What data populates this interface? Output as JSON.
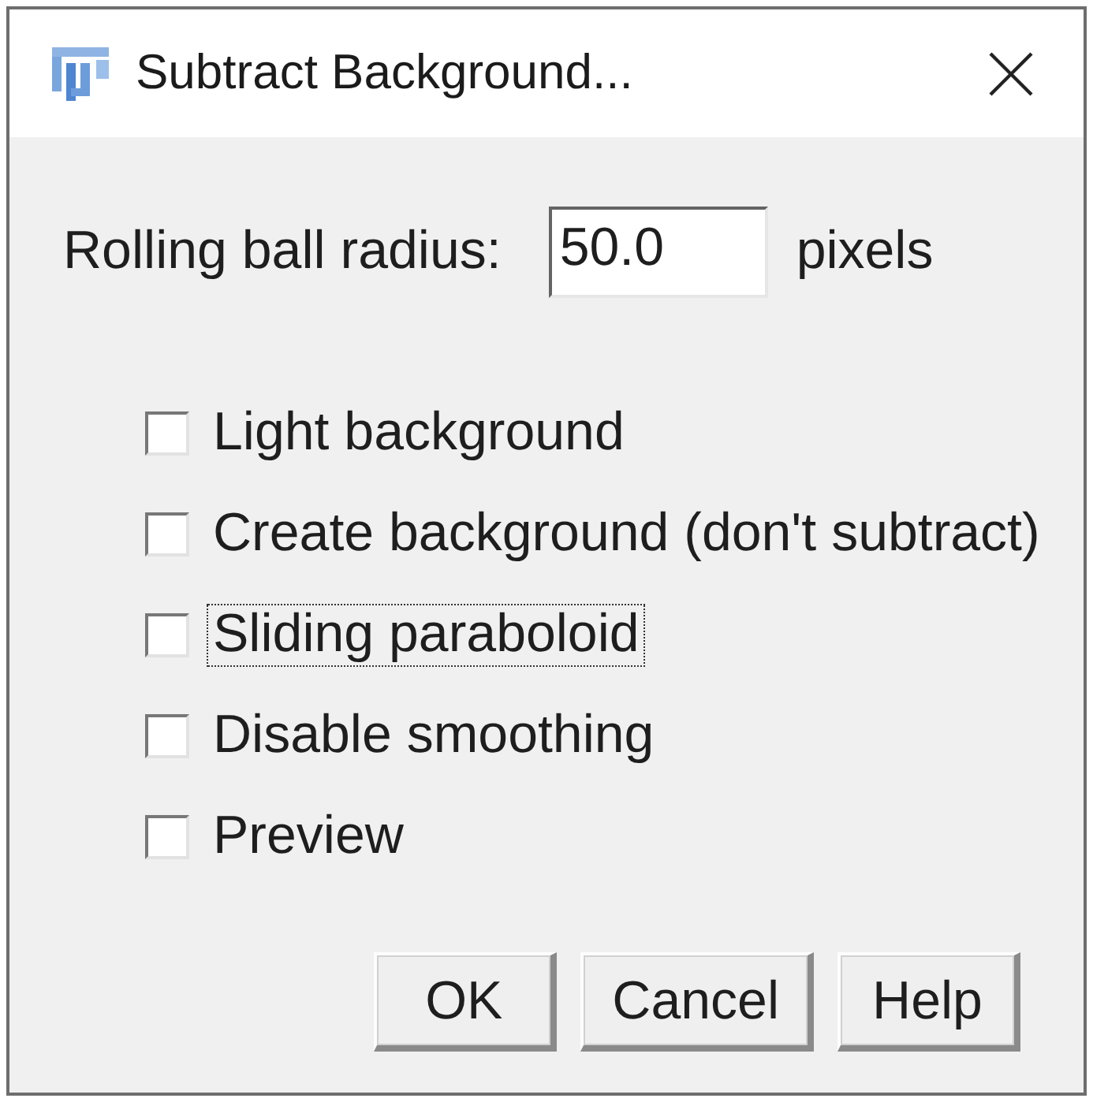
{
  "window": {
    "title": "Subtract Background..."
  },
  "radius": {
    "label": "Rolling ball radius:",
    "value": "50.0",
    "unit": "pixels"
  },
  "options": [
    {
      "label": "Light background",
      "checked": false,
      "focused": false
    },
    {
      "label": "Create background (don't subtract)",
      "checked": false,
      "focused": false
    },
    {
      "label": "Sliding paraboloid",
      "checked": false,
      "focused": true
    },
    {
      "label": "Disable smoothing",
      "checked": false,
      "focused": false
    },
    {
      "label": "Preview",
      "checked": false,
      "focused": false
    }
  ],
  "buttons": [
    {
      "label": "OK"
    },
    {
      "label": "Cancel"
    },
    {
      "label": "Help"
    }
  ]
}
